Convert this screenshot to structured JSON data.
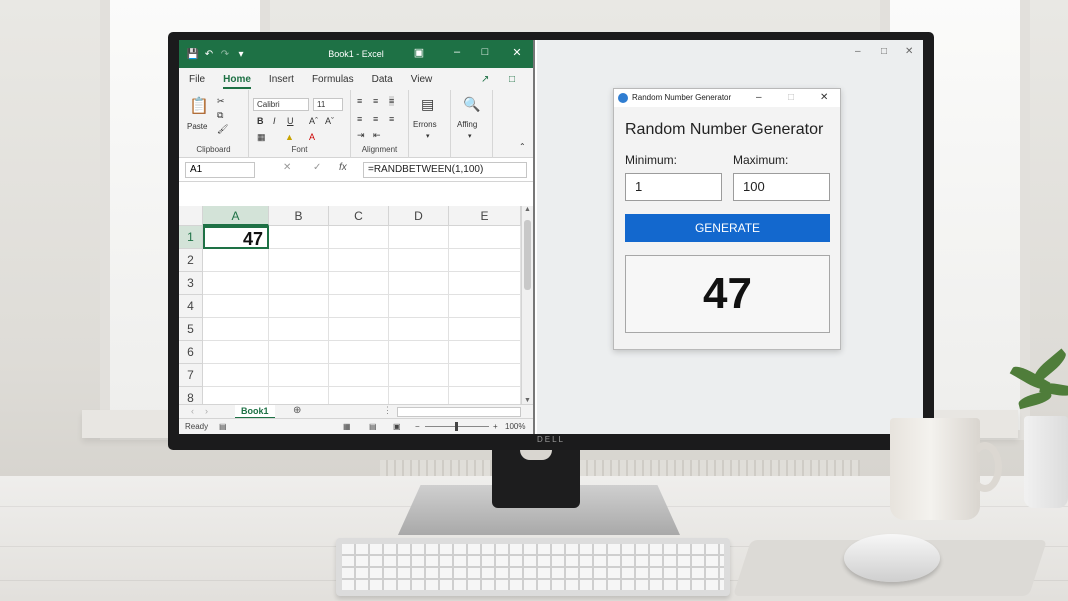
{
  "monitor": {
    "brand": "DELL"
  },
  "excel": {
    "title": "Book1 - Excel",
    "menu_tabs": [
      "File",
      "Home",
      "Insert",
      "Formulas",
      "Data",
      "View"
    ],
    "active_tab": "Home",
    "ribbon": {
      "clipboard": {
        "paste_label": "Paste",
        "group_label": "Clipboard"
      },
      "font": {
        "font_name": "Calibri",
        "font_size": "11",
        "group_label": "Font"
      },
      "alignment": {
        "group_label": "Alignment"
      },
      "errors_label": "Errons",
      "affing_label": "Affing"
    },
    "name_box": "A1",
    "formula": "=RANDBETWEEN(1,100)",
    "columns": [
      "A",
      "B",
      "C",
      "D",
      "E"
    ],
    "rows": [
      "1",
      "2",
      "3",
      "4",
      "5",
      "6",
      "7",
      "8"
    ],
    "cells": {
      "A1": "47"
    },
    "sheet_tab": "Book1",
    "status": "Ready",
    "zoom": "100%",
    "accent_color": "#1e7145"
  },
  "rng_app": {
    "window_title": "Random Number Generator",
    "heading": "Random Number Generator",
    "min_label": "Minimum:",
    "max_label": "Maximum:",
    "min_value": "1",
    "max_value": "100",
    "button_label": "GENERATE",
    "result": "47",
    "button_color": "#1368ce"
  }
}
